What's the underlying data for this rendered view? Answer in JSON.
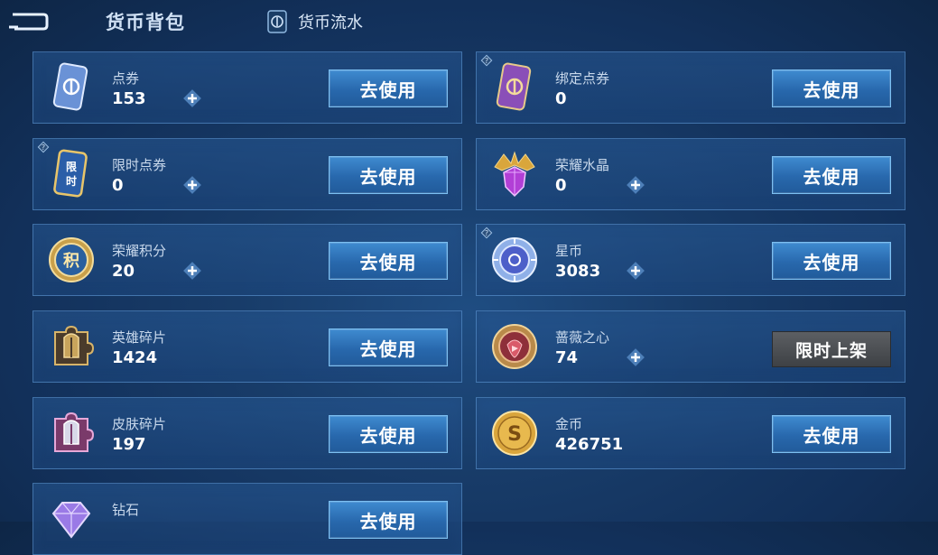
{
  "header": {
    "title": "货币背包",
    "flow_label": "货币流水"
  },
  "currencies": [
    {
      "name": "点券",
      "amount": "153",
      "button": "去使用"
    },
    {
      "name": "绑定点券",
      "amount": "0",
      "button": "去使用"
    },
    {
      "name": "限时点券",
      "amount": "0",
      "button": "去使用",
      "icon_text": "限时"
    },
    {
      "name": "荣耀水晶",
      "amount": "0",
      "button": "去使用"
    },
    {
      "name": "荣耀积分",
      "amount": "20",
      "button": "去使用",
      "icon_text": "积"
    },
    {
      "name": "星币",
      "amount": "3083",
      "button": "去使用"
    },
    {
      "name": "英雄碎片",
      "amount": "1424",
      "button": "去使用"
    },
    {
      "name": "蔷薇之心",
      "amount": "74",
      "button": "限时上架"
    },
    {
      "name": "皮肤碎片",
      "amount": "197",
      "button": "去使用"
    },
    {
      "name": "金币",
      "amount": "426751",
      "button": "去使用"
    },
    {
      "name": "钻石",
      "amount": "",
      "button": "去使用"
    }
  ],
  "icons": {
    "back": "back-arrow-icon",
    "flow": "coin-flow-icon",
    "plus": "plus-icon",
    "help": "help-question-icon"
  },
  "colors": {
    "button_blue": "#2868ad",
    "button_disabled": "#4a4d51",
    "card_border": "#6eaae6"
  }
}
